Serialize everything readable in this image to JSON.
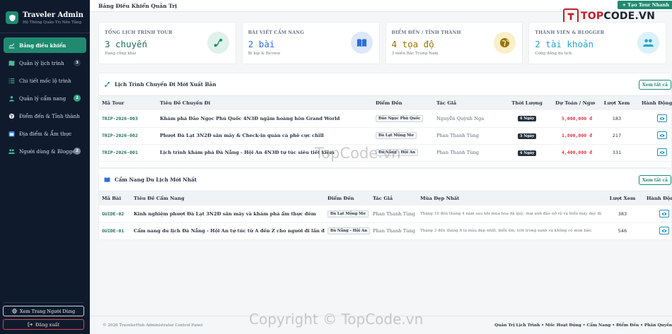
{
  "sidebar": {
    "brand_title": "Traveler Admin",
    "brand_subtitle": "Hệ Thống Quản Trị Nền Tảng",
    "items": [
      {
        "label": "Bảng điều khiển",
        "icon": "chart-line-icon",
        "badge": ""
      },
      {
        "label": "Quản lý lịch trình",
        "icon": "map-icon",
        "badge": "3"
      },
      {
        "label": "Chi tiết mốc lộ trình",
        "icon": "list-icon",
        "badge": ""
      },
      {
        "label": "Quản lý cẩm nang",
        "icon": "people-icon",
        "badge": "2"
      },
      {
        "label": "Điểm đến & Tỉnh thành",
        "icon": "globe-icon",
        "badge": ""
      },
      {
        "label": "Địa điểm & Ẩm thực",
        "icon": "calendar-icon",
        "badge": ""
      },
      {
        "label": "Người dùng & Blogger",
        "icon": "users-icon",
        "badge": "2"
      }
    ],
    "view_site_label": "Xem Trang Người Dùng",
    "logout_label": "Đăng xuất"
  },
  "topbar": {
    "title": "Bảng Điều Khiển Quản Trị",
    "new_tour_label": "+ Tạo Tour Nhanh"
  },
  "logo": {
    "prefix": "TOP",
    "suffix": "CODE.VN"
  },
  "colors": {
    "accent": "#1f8a70",
    "sidebar": "#0f1b2d",
    "price": "#d8333f"
  },
  "stats": [
    {
      "label": "TỔNG LỊCH TRÌNH TOUR",
      "value": "3 chuyến",
      "sub": "Đang công khai",
      "icon": "route-icon",
      "color": "#1f8a70",
      "bg": "#dff1ea"
    },
    {
      "label": "BÀI VIẾT CẨM NANG",
      "value": "2 bài",
      "sub": "Bí kíp & Review",
      "icon": "book-icon",
      "color": "#2f6fd6",
      "bg": "#dde8f8"
    },
    {
      "label": "ĐIỂM ĐẾN / TỈNH THÀNH",
      "value": "4 tọa độ",
      "sub": "3 miền Bắc Trung Nam",
      "icon": "globe-icon",
      "color": "#9a7400",
      "bg": "#fbefc7"
    },
    {
      "label": "THÀNH VIÊN & BLOGGER",
      "value": "2 tài khoản",
      "sub": "Cộng đồng du lịch",
      "icon": "users-icon",
      "color": "#2aa6c9",
      "bg": "#d9f1f8"
    }
  ],
  "tours": {
    "title": "Lịch Trình Chuyến Đi Mới Xuất Bản",
    "view_all": "Xem tất cả",
    "headers": [
      "Mã Tour",
      "Tiêu Đề Chuyến Đi",
      "Điểm Đến",
      "Tác Giả",
      "Thời Lượng",
      "Dự Toán / Người",
      "Lượt Xem",
      "Hành Động"
    ],
    "rows": [
      {
        "code": "TRIP-2026-003",
        "title": "Khám phá Đảo Ngọc Phú Quốc 4N3Đ ngậm hoàng hôn Grand World",
        "dest": "Đảo Ngọc Phú Quốc",
        "author": "Nguyễn Quỳnh Nga",
        "duration": "4 Ngày",
        "price": "5,000,000 đ",
        "views": "183"
      },
      {
        "code": "TRIP-2026-002",
        "title": "Phượt Đà Lạt 3N2Đ săn mây & Check-in quán cà phê cực chill",
        "dest": "Đà Lạt Mộng Mơ",
        "author": "Phan Thanh Tùng",
        "duration": "3 Ngày",
        "price": "1,800,000 đ",
        "views": "217"
      },
      {
        "code": "TRIP-2026-001",
        "title": "Lịch trình khám phá Đà Nẵng - Hội An 4N3Đ tự túc siêu tiết kiệm",
        "dest": "Đà Nẵng - Hội An",
        "author": "Phan Thanh Tùng",
        "duration": "4 Ngày",
        "price": "4,400,000 đ",
        "views": "331"
      }
    ]
  },
  "guides": {
    "title": "Cẩm Nang Du Lịch Mới Nhất",
    "view_all": "Xem tất cả",
    "headers": [
      "Mã Bài",
      "Tiêu Đề Cẩm Nang",
      "Điểm Đến",
      "Tác Giả",
      "Mùa Đẹp Nhất",
      "Lượt Xem",
      "Hành Động"
    ],
    "rows": [
      {
        "code": "GUIDE-02",
        "title": "Kinh nghiệm phượt Đà Lạt 3N2Đ săn mây và khám phá ẩm thực đêm",
        "dest": "Đà Lạt Mộng Mơ",
        "author": "Phan Thanh Tùng",
        "season": "Tháng 10 đến tháng 4 năm sau khi mùa hoa dã quỳ, mai anh đào nở rộ và biển mây dày đặc.",
        "views": "383"
      },
      {
        "code": "GUIDE-01",
        "title": "Cẩm nang du lịch Đà Nẵng - Hội An tự túc từ A đến Z cho người đi lần đầu",
        "dest": "Đà Nẵng - Hội An",
        "author": "Phan Thanh Tùng",
        "season": "Tháng 3 đến tháng 8 là mùa đẹp nhất, biển êm, trời trong xanh và không có mưa bão.",
        "views": "546"
      }
    ]
  },
  "footer": {
    "left": "© 2026 TravelerHub Administrator Control Panel",
    "right": "Quản Trị Lịch Trình • Mốc Hoạt Động • Cẩm Nang • Điểm Đến • Phân Quyền"
  },
  "watermarks": {
    "center": "TopCode.vn",
    "bottom": "Copyright © TopCode.vn"
  }
}
